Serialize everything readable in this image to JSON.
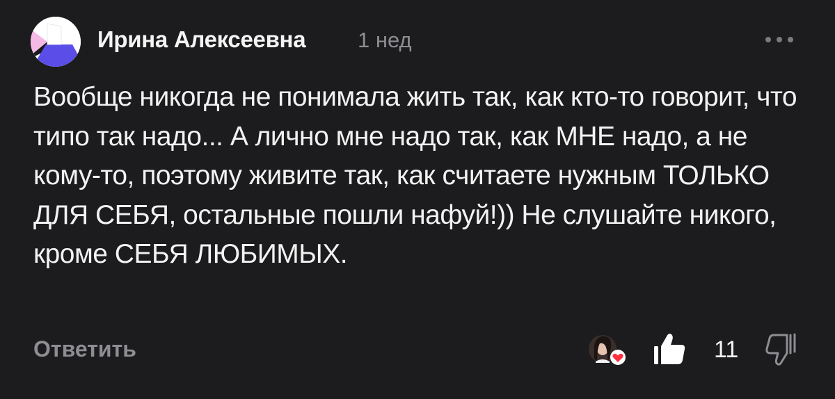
{
  "comment": {
    "author": "Ирина Алексеевна",
    "time": "1 нед",
    "text": "Вообще никогда не понимала жить так, как кто-то говорит, что типо так надо... А лично мне надо так, как МНЕ надо, а не кому-то, поэтому живите так, как считаете нужным ТОЛЬКО ДЛЯ СЕБЯ, остальные пошли нафуй!)) Не слушайте никого, кроме СЕБЯ ЛЮБИМЫХ.",
    "reply_label": "Ответить",
    "like_count": "11"
  },
  "icons": {
    "avatar": "abstract-avatar",
    "more": "more-dots-icon",
    "liker_badge": "heart-icon",
    "like": "thumb-up-icon",
    "dislike": "thumb-down-icon"
  },
  "colors": {
    "background": "#1c1b1d",
    "text": "#f2f2f2",
    "muted": "#8e8d92",
    "heart": "#ff3040"
  }
}
